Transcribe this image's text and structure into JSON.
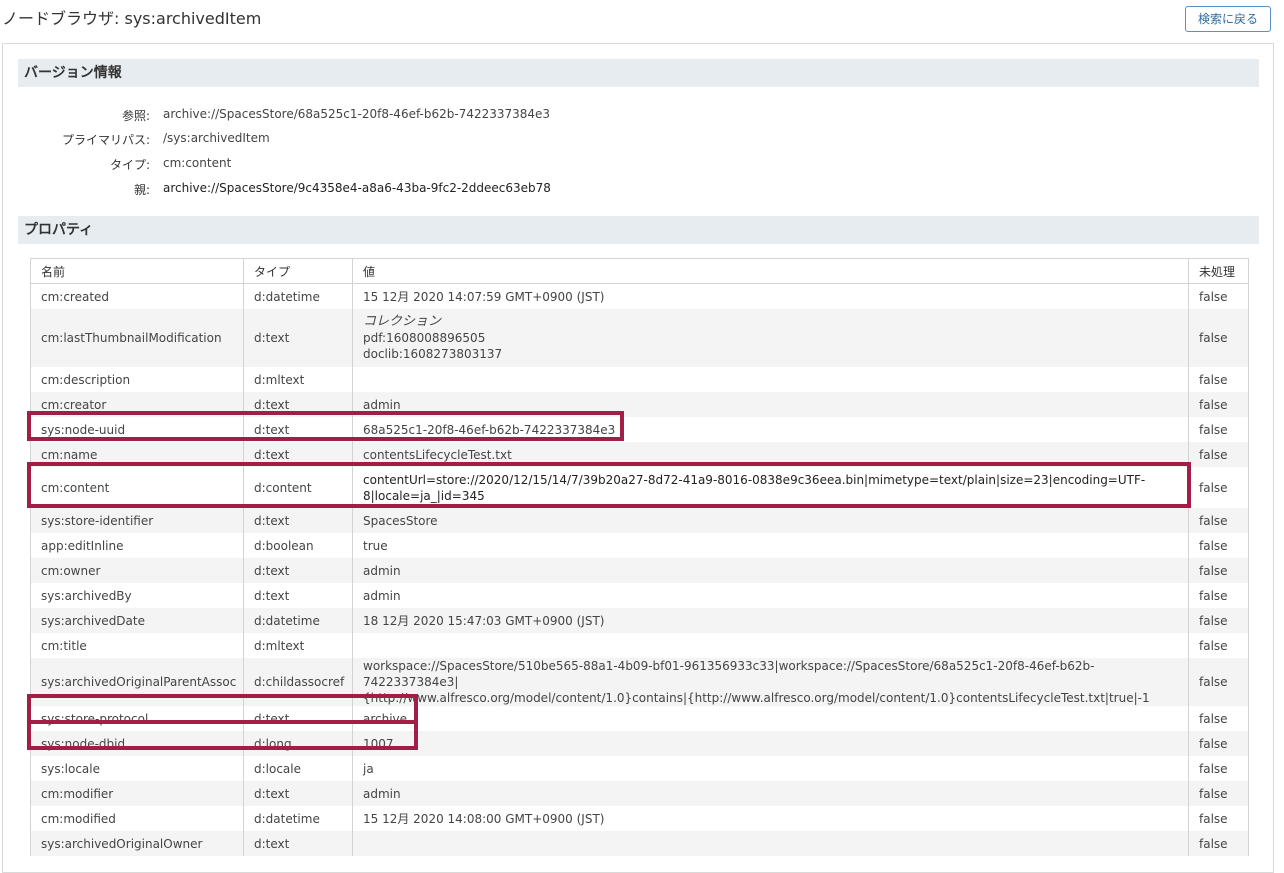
{
  "page": {
    "title": "ノードブラウザ: sys:archivedItem",
    "back_button": "検索に戻る"
  },
  "version_info": {
    "heading": "バージョン情報",
    "rows": [
      {
        "label": "参照:",
        "value": "archive://SpacesStore/68a525c1-20f8-46ef-b62b-7422337384e3"
      },
      {
        "label": "プライマリパス:",
        "value": "/sys:archivedItem"
      },
      {
        "label": "タイプ:",
        "value": "cm:content"
      },
      {
        "label": "親:",
        "value": "archive://SpacesStore/9c4358e4-a8a6-43ba-9fc2-2ddeec63eb78"
      }
    ]
  },
  "properties": {
    "heading": "プロパティ",
    "columns": [
      "名前",
      "タイプ",
      "値",
      "未処理"
    ],
    "rows": [
      {
        "name": "cm:created",
        "type": "d:datetime",
        "value": "15 12月 2020 14:07:59 GMT+0900 (JST)",
        "raw": "false"
      },
      {
        "name": "cm:lastThumbnailModification",
        "type": "d:text",
        "value_title": "コレクション",
        "value_lines": [
          "pdf:1608008896505",
          "doclib:1608273803137"
        ],
        "raw": "false"
      },
      {
        "name": "cm:description",
        "type": "d:mltext",
        "value": "",
        "raw": "false"
      },
      {
        "name": "cm:creator",
        "type": "d:text",
        "value": "admin",
        "raw": "false"
      },
      {
        "name": "sys:node-uuid",
        "type": "d:text",
        "value": "68a525c1-20f8-46ef-b62b-7422337384e3",
        "raw": "false"
      },
      {
        "name": "cm:name",
        "type": "d:text",
        "value": "contentsLifecycleTest.txt",
        "raw": "false"
      },
      {
        "name": "cm:content",
        "type": "d:content",
        "value_lines": [
          "contentUrl=store://2020/12/15/14/7/39b20a27-8d72-41a9-8016-0838e9c36eea.bin|mimetype=text/plain|size=23|encoding=UTF-",
          "8|locale=ja_|id=345"
        ],
        "raw": "false"
      },
      {
        "name": "sys:store-identifier",
        "type": "d:text",
        "value": "SpacesStore",
        "raw": "false"
      },
      {
        "name": "app:editInline",
        "type": "d:boolean",
        "value": "true",
        "raw": "false"
      },
      {
        "name": "cm:owner",
        "type": "d:text",
        "value": "admin",
        "raw": "false"
      },
      {
        "name": "sys:archivedBy",
        "type": "d:text",
        "value": "admin",
        "raw": "false"
      },
      {
        "name": "sys:archivedDate",
        "type": "d:datetime",
        "value": "18 12月 2020 15:47:03 GMT+0900 (JST)",
        "raw": "false"
      },
      {
        "name": "cm:title",
        "type": "d:mltext",
        "value": "",
        "raw": "false"
      },
      {
        "name": "sys:archivedOriginalParentAssoc",
        "type": "d:childassocref",
        "value_lines": [
          "workspace://SpacesStore/510be565-88a1-4b09-bf01-961356933c33|workspace://SpacesStore/68a525c1-20f8-46ef-b62b-7422337384e3|",
          "{http://www.alfresco.org/model/content/1.0}contains|{http://www.alfresco.org/model/content/1.0}contentsLifecycleTest.txt|true|-1"
        ],
        "raw": "false"
      },
      {
        "name": "sys:store-protocol",
        "type": "d:text",
        "value": "archive",
        "raw": "false"
      },
      {
        "name": "sys:node-dbid",
        "type": "d:long",
        "value": "1007",
        "raw": "false"
      },
      {
        "name": "sys:locale",
        "type": "d:locale",
        "value": "ja",
        "raw": "false"
      },
      {
        "name": "cm:modifier",
        "type": "d:text",
        "value": "admin",
        "raw": "false"
      },
      {
        "name": "cm:modified",
        "type": "d:datetime",
        "value": "15 12月 2020 14:08:00 GMT+0900 (JST)",
        "raw": "false"
      },
      {
        "name": "sys:archivedOriginalOwner",
        "type": "d:text",
        "value": "",
        "raw": "false"
      }
    ]
  },
  "colors": {
    "highlight": "#a31d46",
    "section_header_bg": "#e6ecef",
    "button_border": "#5a8fc8"
  }
}
